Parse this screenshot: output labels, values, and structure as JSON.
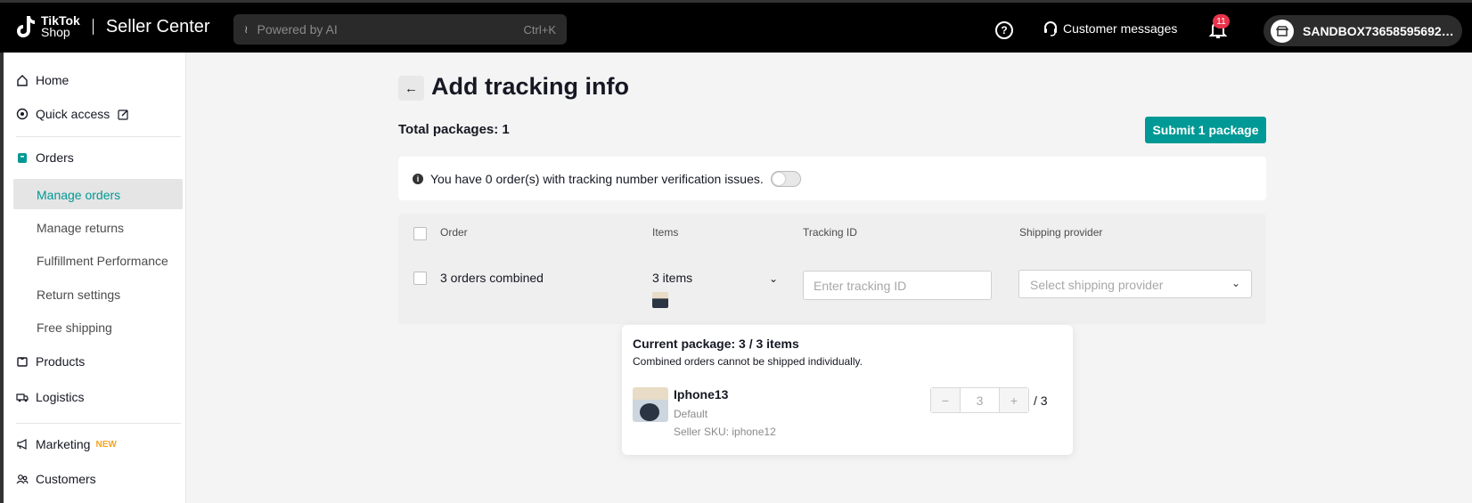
{
  "header": {
    "logo_word1": "TikTok",
    "logo_word2": "Shop",
    "title": "Seller Center",
    "search_placeholder": "Powered by AI",
    "search_shortcut": "Ctrl+K",
    "customer_messages": "Customer messages",
    "notification_count": "11",
    "account_name": "SANDBOX736585956927..."
  },
  "sidebar": {
    "home": "Home",
    "quick_access": "Quick access",
    "orders": "Orders",
    "manage_orders": "Manage orders",
    "manage_returns": "Manage returns",
    "fulfillment_performance": "Fulfillment Performance",
    "return_settings": "Return settings",
    "free_shipping": "Free shipping",
    "products": "Products",
    "logistics": "Logistics",
    "marketing": "Marketing",
    "marketing_tag": "NEW",
    "customers": "Customers"
  },
  "main": {
    "title": "Add tracking info",
    "total_packages": "Total packages: 1",
    "submit_label": "Submit 1 package",
    "notice_text": "You have 0 order(s) with tracking number verification issues.",
    "columns": {
      "order": "Order",
      "items": "Items",
      "tracking_id": "Tracking ID",
      "shipping_provider": "Shipping provider"
    },
    "row": {
      "order": "3 orders combined",
      "items": "3 items",
      "tracking_placeholder": "Enter tracking ID",
      "shipping_placeholder": "Select shipping provider"
    }
  },
  "popover": {
    "title": "Current package: 3 / 3 items",
    "subtitle": "Combined orders cannot be shipped individually.",
    "product_name": "Iphone13",
    "variant": "Default",
    "sku": "Seller SKU: iphone12",
    "quantity": "3",
    "max": "/ 3"
  },
  "colors": {
    "accent": "#009995",
    "badge": "#e8344b",
    "new_tag": "#f5a524"
  }
}
